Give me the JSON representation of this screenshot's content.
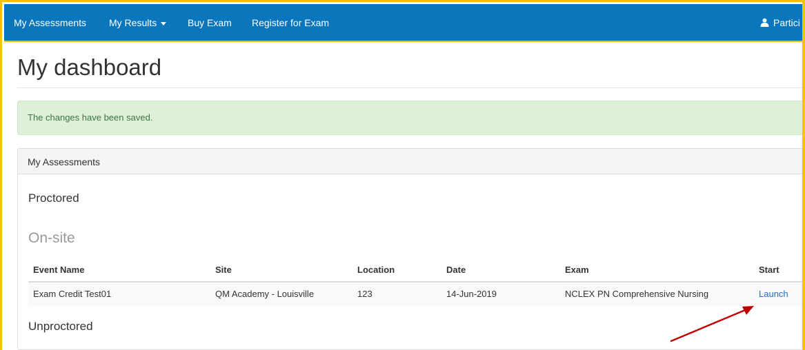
{
  "nav": {
    "items": [
      {
        "label": "My Assessments"
      },
      {
        "label": "My Results"
      },
      {
        "label": "Buy Exam"
      },
      {
        "label": "Register for Exam"
      }
    ],
    "user_label": "Partici"
  },
  "page": {
    "title": "My dashboard"
  },
  "alert": {
    "message": "The changes have been saved."
  },
  "panel": {
    "heading": "My Assessments",
    "proctored_title": "Proctored",
    "onsite_title": "On-site",
    "unproctored_title": "Unproctored",
    "table": {
      "columns": [
        "Event Name",
        "Site",
        "Location",
        "Date",
        "Exam",
        "Start"
      ],
      "rows": [
        {
          "event_name": "Exam Credit Test01",
          "site": "QM Academy - Louisville",
          "location": "123",
          "date": "14-Jun-2019",
          "exam": "NCLEX PN Comprehensive Nursing",
          "start": "Launch"
        }
      ]
    }
  },
  "colors": {
    "navbar": "#0a77bd",
    "frame_border": "#f5c400",
    "alert_bg": "#dff0d8",
    "alert_text": "#3c763d",
    "link": "#2a6fb6",
    "annotation_arrow": "#c00000"
  },
  "icons": {
    "user": "user-icon",
    "dropdown": "caret-down-icon",
    "annotation": "arrow-icon"
  }
}
